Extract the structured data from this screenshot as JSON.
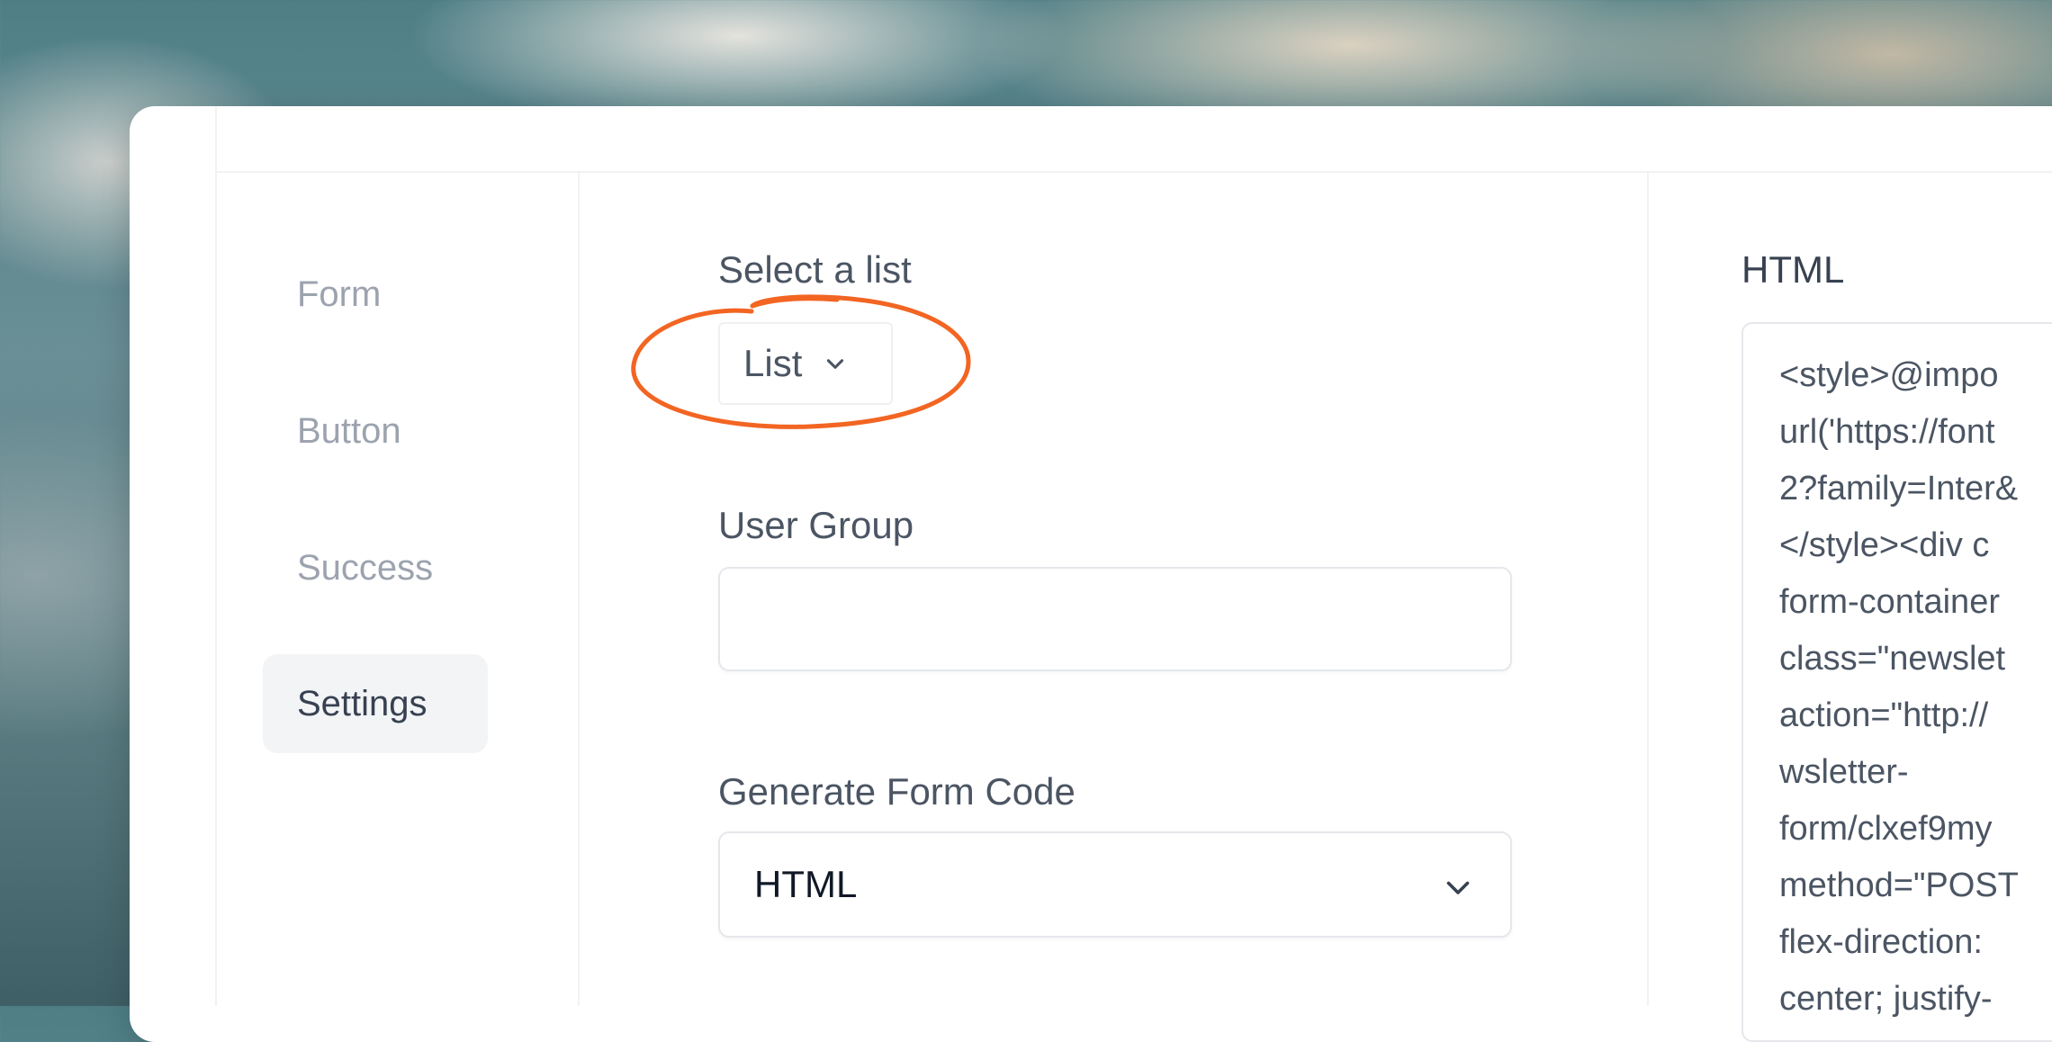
{
  "nav": {
    "items": [
      {
        "label": "Form",
        "active": false
      },
      {
        "label": "Button",
        "active": false
      },
      {
        "label": "Success",
        "active": false
      },
      {
        "label": "Settings",
        "active": true
      }
    ]
  },
  "settings": {
    "select_list_label": "Select a list",
    "list_dropdown_value": "List",
    "user_group_label": "User Group",
    "user_group_value": "",
    "generate_code_label": "Generate Form Code",
    "generate_code_value": "HTML"
  },
  "output": {
    "title": "HTML",
    "code_lines": [
      "<style>@impo",
      "url('https://font",
      "2?family=Inter&",
      "</style><div c",
      "form-container",
      "class=\"newslet",
      "action=\"http://",
      "wsletter-",
      "form/clxef9my",
      "method=\"POST",
      "flex-direction:",
      "center; justify-"
    ]
  },
  "colors": {
    "annotation": "#f26522",
    "active_nav_bg": "#f3f4f6"
  },
  "icons": {
    "list_dropdown": "chevron-down-icon",
    "code_select": "chevron-down-icon"
  }
}
